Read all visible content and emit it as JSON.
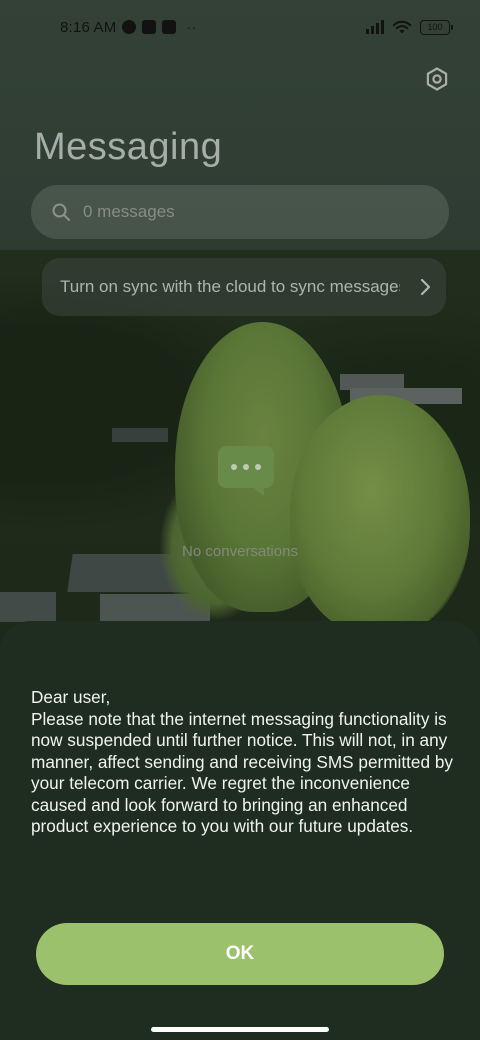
{
  "status_bar": {
    "time": "8:16 AM",
    "battery": "100",
    "overflow": "··"
  },
  "app": {
    "title": "Messaging",
    "settings_icon": "hexagon-gear-icon",
    "search": {
      "placeholder": "0 messages",
      "icon": "search-icon"
    },
    "sync_banner": {
      "text": "Turn on sync with the cloud to sync messages",
      "icon": "chevron-right-icon"
    },
    "empty_state": {
      "icon": "chat-bubble-icon",
      "text": "No conversations"
    }
  },
  "dialog": {
    "message_lines": [
      "Dear user,",
      "Please note that the internet messaging functionality is now suspended until further notice. This will not, in any manner, affect sending and receiving SMS permitted by your telecom carrier. We regret the inconvenience caused and look forward to bringing an enhanced product experience to you with our future updates."
    ],
    "ok_label": "OK"
  },
  "colors": {
    "accent": "#9cc16c",
    "sheet_bg": "#1f2d20",
    "empty_icon": "#7aa456"
  }
}
